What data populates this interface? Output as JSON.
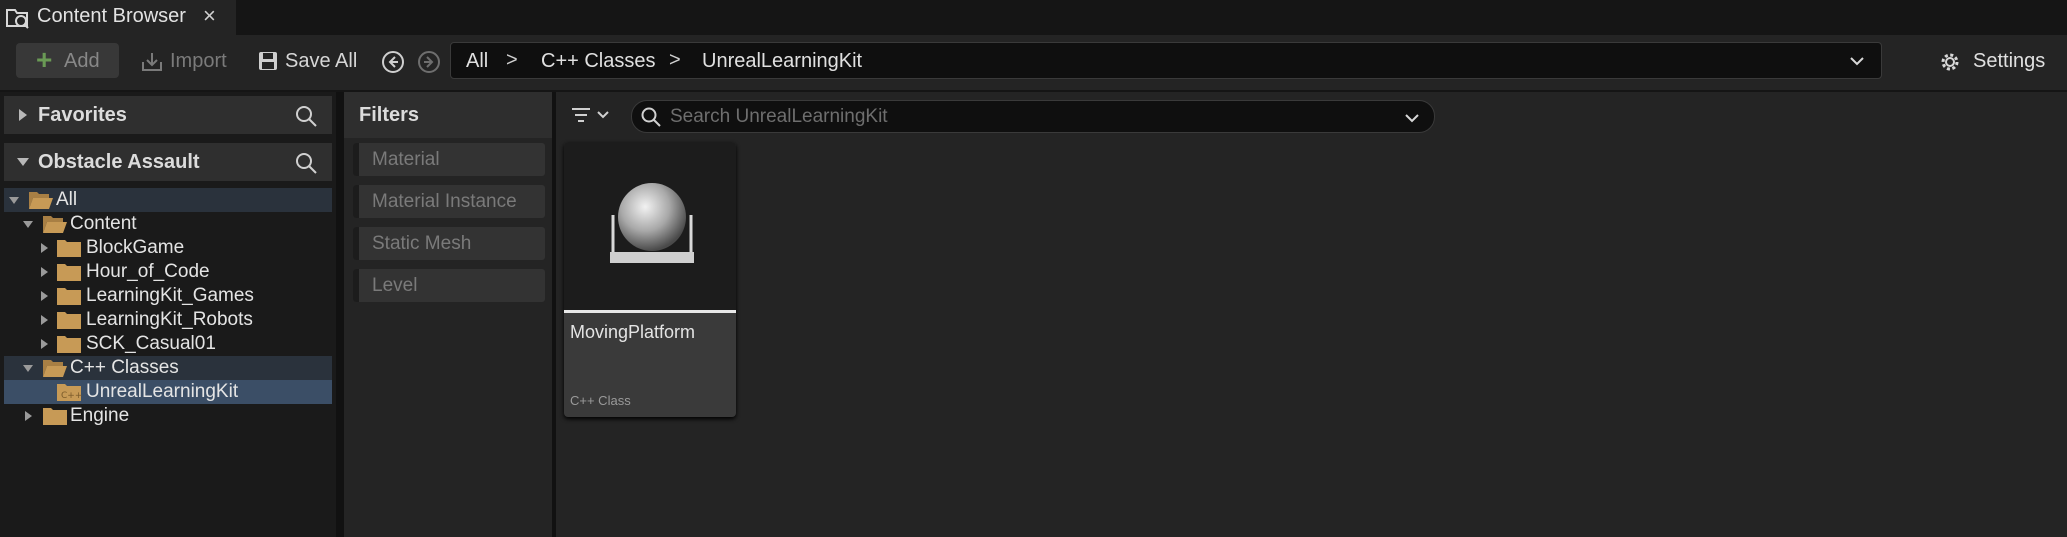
{
  "tab": {
    "title": "Content Browser",
    "close_glyph": "×",
    "icon": "content-browser-icon"
  },
  "toolbar": {
    "add_label": "Add",
    "import_label": "Import",
    "save_all_label": "Save All",
    "settings_label": "Settings"
  },
  "breadcrumb": {
    "items": [
      "All",
      "C++ Classes",
      "UnrealLearningKit"
    ],
    "separator": ">"
  },
  "sidebar": {
    "favorites_label": "Favorites",
    "project_label": "Obstacle Assault",
    "tree": [
      {
        "label": "All",
        "expanded": true,
        "icon": "folder-open-icon"
      },
      {
        "label": "Content",
        "expanded": true,
        "icon": "folder-open-icon"
      },
      {
        "label": "BlockGame",
        "expanded": false,
        "icon": "folder-icon"
      },
      {
        "label": "Hour_of_Code",
        "expanded": false,
        "icon": "folder-icon"
      },
      {
        "label": "LearningKit_Games",
        "expanded": false,
        "icon": "folder-icon"
      },
      {
        "label": "LearningKit_Robots",
        "expanded": false,
        "icon": "folder-icon"
      },
      {
        "label": "SCK_Casual01",
        "expanded": false,
        "icon": "folder-icon"
      },
      {
        "label": "C++ Classes",
        "expanded": true,
        "icon": "folder-open-icon"
      },
      {
        "label": "UnrealLearningKit",
        "selected": true,
        "icon": "cpp-folder-icon"
      },
      {
        "label": "Engine",
        "expanded": false,
        "icon": "folder-icon"
      }
    ]
  },
  "filters": {
    "title": "Filters",
    "items": [
      "Material",
      "Material Instance",
      "Static Mesh",
      "Level"
    ]
  },
  "search": {
    "placeholder": "Search UnrealLearningKit",
    "value": ""
  },
  "assets": [
    {
      "name": "MovingPlatform",
      "type": "C++ Class",
      "thumbnail": "sphere-on-base-icon"
    }
  ],
  "colors": {
    "accent_selected": "#3b4e66",
    "folder": "#c79a56",
    "add_plus": "#6a9a55",
    "background": "#242424"
  }
}
